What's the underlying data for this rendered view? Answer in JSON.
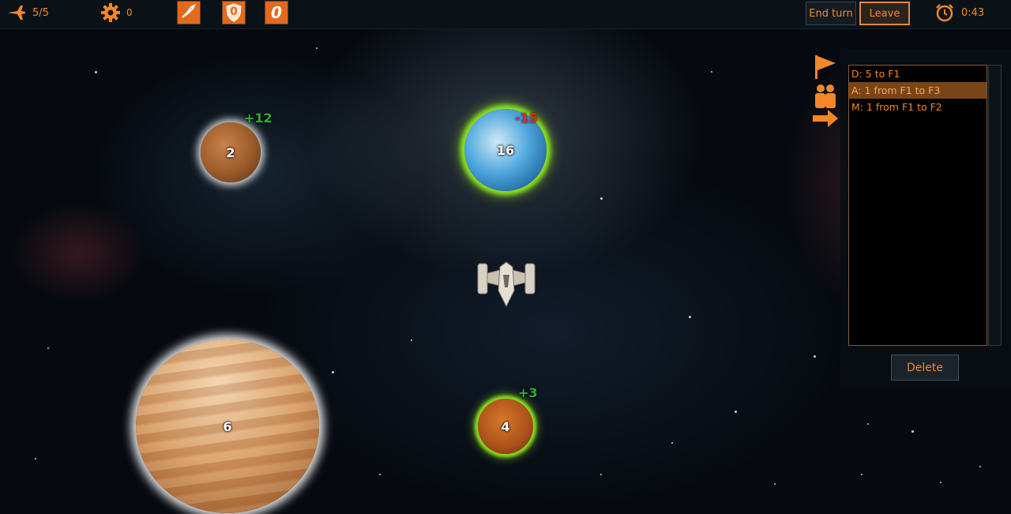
{
  "hud": {
    "ships": "5/5",
    "resources": "0",
    "slot2_value": "0",
    "slot3_value": "0",
    "timer": "0:43"
  },
  "buttons": {
    "end_turn": "End turn",
    "leave": "Leave",
    "delete": "Delete"
  },
  "planets": [
    {
      "id": "planet-mars",
      "count": "2",
      "delta": "+12",
      "delta_color": "#2fae2f"
    },
    {
      "id": "planet-earth",
      "count": "16",
      "delta": "-15",
      "delta_color": "#e22c1c"
    },
    {
      "id": "planet-jupiter",
      "count": "6",
      "delta": "",
      "delta_color": ""
    },
    {
      "id": "planet-small-orange",
      "count": "4",
      "delta": "+3",
      "delta_color": "#2fae2f"
    }
  ],
  "orders": [
    {
      "text": "D: 5 to F1",
      "selected": false
    },
    {
      "text": "A: 1 from F1 to F3",
      "selected": true
    },
    {
      "text": "M: 1 from F1 to F2",
      "selected": false
    }
  ],
  "colors": {
    "accent": "#f3872a",
    "glow_green": "#8ee21f",
    "glow_white": "#ffffff"
  },
  "icons": [
    "ship-icon",
    "gear-icon",
    "rocket-card-icon",
    "shield-card-icon",
    "zero-card-icon",
    "alarm-clock-icon",
    "flag-icon",
    "group-icon",
    "arrow-right-icon"
  ]
}
